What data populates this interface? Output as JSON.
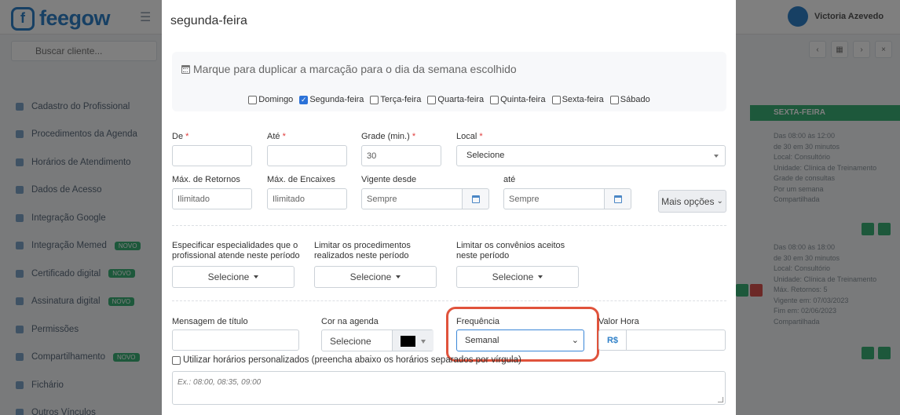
{
  "background": {
    "logo_text": "feegow",
    "search_placeholder": "Buscar cliente...",
    "user_name": "Victoria Azevedo",
    "sidebar_items": [
      {
        "label": "Cadastro do Profissional"
      },
      {
        "label": "Procedimentos da Agenda"
      },
      {
        "label": "Horários de Atendimento"
      },
      {
        "label": "Dados de Acesso"
      },
      {
        "label": "Integração Google"
      },
      {
        "label": "Integração Memed",
        "badge": "NOVO"
      },
      {
        "label": "Certificado digital",
        "badge": "NOVO"
      },
      {
        "label": "Assinatura digital",
        "badge": "NOVO"
      },
      {
        "label": "Permissões"
      },
      {
        "label": "Compartilhamento",
        "badge": "NOVO"
      },
      {
        "label": "Fichário"
      },
      {
        "label": "Outros Vínculos"
      }
    ],
    "column_header": "SEXTA-FEIRA",
    "column_lines": [
      "Das 08:00 às 12:00",
      "de 30 em 30 minutos",
      "Local: Consultório",
      "Unidade: Clínica de Treinamento",
      "Grade de consultas",
      "Por um semana",
      "Compartilhada"
    ],
    "column_lines_2": [
      "Das 08:00 às 18:00",
      "de 30 em 30 minutos",
      "Local: Consultório",
      "Unidade: Clínica de Treinamento",
      "Máx. Retornos: 5",
      "Vigente em: 07/03/2023",
      "Fim em: 02/06/2023",
      "Compartilhada"
    ]
  },
  "modal": {
    "title": "segunda-feira",
    "duplicate": {
      "title": "Marque para duplicar a marcação para o dia da semana escolhido",
      "days": [
        {
          "label": "Domingo",
          "checked": false
        },
        {
          "label": "Segunda-feira",
          "checked": true
        },
        {
          "label": "Terça-feira",
          "checked": false
        },
        {
          "label": "Quarta-feira",
          "checked": false
        },
        {
          "label": "Quinta-feira",
          "checked": false
        },
        {
          "label": "Sexta-feira",
          "checked": false
        },
        {
          "label": "Sábado",
          "checked": false
        }
      ]
    },
    "fields": {
      "de_label": "De",
      "ate_label": "Até",
      "grade_label": "Grade (min.)",
      "grade_value": "30",
      "local_label": "Local",
      "local_value": "Selecione",
      "max_retornos_label": "Máx. de Retornos",
      "max_retornos_placeholder": "Ilimitado",
      "max_encaixes_label": "Máx. de Encaixes",
      "max_encaixes_placeholder": "Ilimitado",
      "vigente_desde_label": "Vigente desde",
      "vigente_desde_placeholder": "Sempre",
      "vigente_ate_label": "até",
      "vigente_ate_placeholder": "Sempre",
      "mais_opcoes": "Mais opções",
      "required_mark": "*"
    },
    "limits": {
      "especialidades_label": "Especificar especialidades que o profissional atende neste período",
      "procedimentos_label": "Limitar os procedimentos realizados neste período",
      "convenios_label": "Limitar os convênios aceitos neste período",
      "select_label": "Selecione"
    },
    "bottom": {
      "mensagem_label": "Mensagem de título",
      "cor_label": "Cor na agenda",
      "cor_value": "Selecione",
      "cor_color": "#000000",
      "frequencia_label": "Frequência",
      "frequencia_value": "Semanal",
      "valor_hora_label": "Valor Hora",
      "currency": "R$",
      "custom_hours_label": "Utilizar horários personalizados (preencha abaixo os horários separados por vírgula)",
      "custom_hours_placeholder": "Ex.: 08:00, 08:35, 09:00"
    },
    "highlight_color": "#e0533c"
  }
}
